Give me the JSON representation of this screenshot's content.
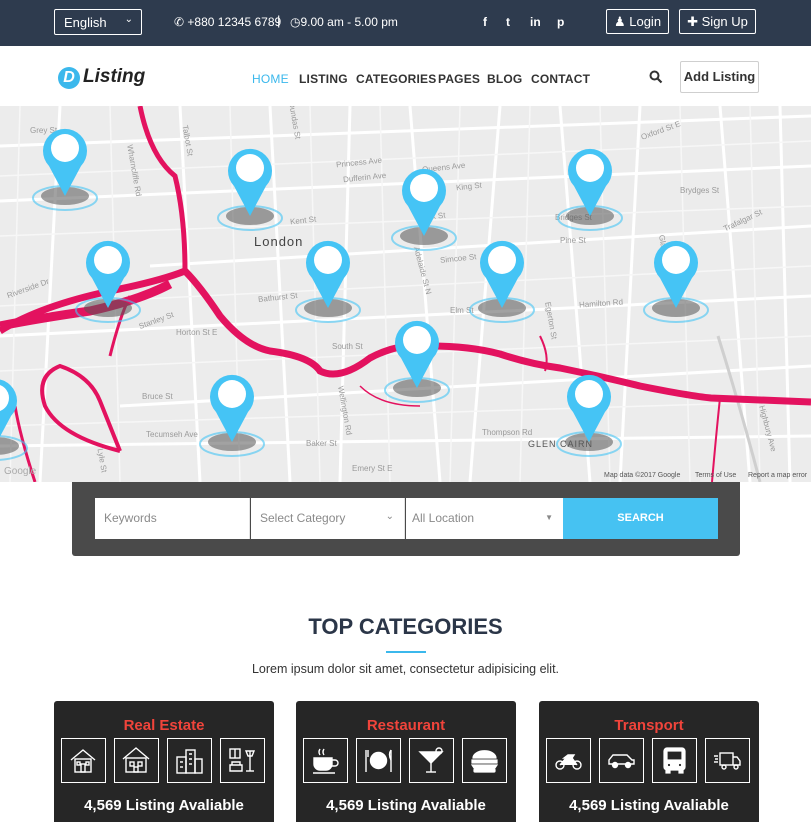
{
  "topbar": {
    "language": "English",
    "phone": "+880 12345 6789",
    "separator": "|",
    "hours": "9.00 am - 5.00 pm",
    "login_label": "Login",
    "signup_label": "Sign Up",
    "social": [
      "f",
      "t",
      "in",
      "p"
    ]
  },
  "brand": {
    "letter": "D",
    "name": "Listing"
  },
  "nav": {
    "items": [
      "HOME",
      "LISTING",
      "CATEGORIES",
      "PAGES",
      "BLOG",
      "CONTACT"
    ],
    "add_listing": "Add Listing"
  },
  "map": {
    "city": "London",
    "district": "GLEN CAIRN",
    "attribution": [
      "Map data ©2017 Google",
      "Terms of Use",
      "Report a map error"
    ],
    "google": "Google",
    "streets": [
      "Talbot St",
      "Dundas St",
      "Princess Ave",
      "Dufferin Ave",
      "Queens Ave",
      "King St",
      "York St",
      "Bathurst St",
      "Horton St E",
      "Hamilton Rd",
      "Adelaide St N",
      "Egerton St",
      "Pine St",
      "Bridges St",
      "Trafalgar St",
      "Wellington Rd",
      "South St",
      "Baker St",
      "Emery St E",
      "Wharncliffe Rd",
      "Riverside Dr",
      "Stanley St",
      "Tecumseh Ave",
      "Bruce St",
      "Highbury Ave",
      "Thompson Rd",
      "Brydges St",
      "Oxford St E",
      "Kent St",
      "Lyle St",
      "Grey St",
      "Simcoe St",
      "Gladstone Ave",
      "Elm St"
    ]
  },
  "search": {
    "keywords_placeholder": "Keywords",
    "category_placeholder": "Select Category",
    "location_placeholder": "All Location",
    "button": "SEARCH"
  },
  "categories": {
    "heading": "TOP CATEGORIES",
    "subtitle": "Lorem ipsum dolor sit amet, consectetur adipisicing elit.",
    "cards": [
      {
        "title": "Real Estate",
        "count": "4,569 Listing Avaliable",
        "icons": [
          "house-icon",
          "villa-icon",
          "buildings-icon",
          "interior-icon"
        ]
      },
      {
        "title": "Restaurant",
        "count": "4,569 Listing Avaliable",
        "icons": [
          "cup-icon",
          "plate-icon",
          "cocktail-icon",
          "burger-icon"
        ]
      },
      {
        "title": "Transport",
        "count": "4,569 Listing Avaliable",
        "icons": [
          "motorbike-icon",
          "car-icon",
          "bus-icon",
          "truck-icon"
        ]
      }
    ]
  },
  "colors": {
    "accent": "#3bb8ec",
    "topbar": "#2e3b4e",
    "pin": "#45c4f5",
    "river": "#e3125f",
    "category_title": "#f0443b"
  }
}
